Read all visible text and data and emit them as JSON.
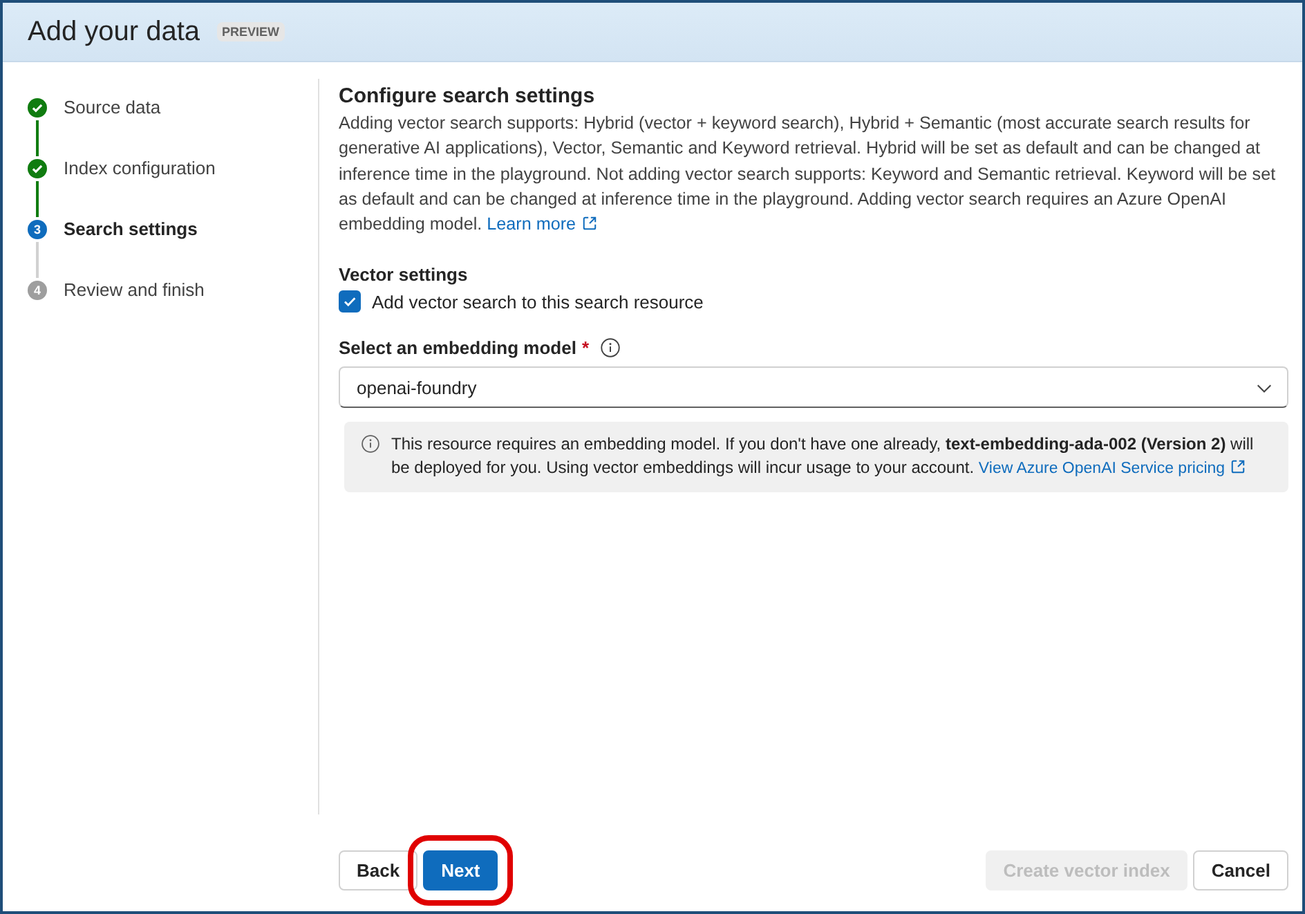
{
  "header": {
    "title": "Add your data",
    "badge": "PREVIEW"
  },
  "steps": [
    {
      "label": "Source data",
      "kind": "done"
    },
    {
      "label": "Index configuration",
      "kind": "done"
    },
    {
      "number": "3",
      "label": "Search settings",
      "kind": "current"
    },
    {
      "number": "4",
      "label": "Review and finish",
      "kind": "pending"
    }
  ],
  "section": {
    "title": "Configure search settings",
    "description": "Adding vector search supports: Hybrid (vector + keyword search), Hybrid + Semantic (most accurate search results for generative AI applications), Vector, Semantic and Keyword retrieval. Hybrid will be set as default and can be changed at inference time in the playground. Not adding vector search supports: Keyword and Semantic retrieval. Keyword will be set as default and can be changed at inference time in the playground. Adding vector search requires an Azure OpenAI embedding model.",
    "link": "Learn more"
  },
  "vector_settings": {
    "title": "Vector settings",
    "checkbox": {
      "label": "Add vector search to this search resource",
      "checked": true
    }
  },
  "model_select": {
    "label": "Select an embedding model",
    "required_mark": "*",
    "value": "openai-foundry"
  },
  "info": {
    "text": "This resource requires an embedding model. If you don't have one already, **text-embedding-ada-002 (Version 2)** will be deployed for you. Using vector embeddings will incur usage to your account.",
    "link": "View Azure OpenAI Service pricing"
  },
  "buttons": [
    {
      "label": "Back",
      "kind": "secondary",
      "disabled": false,
      "highlighted": false
    },
    {
      "label": "Next",
      "kind": "primary",
      "disabled": false,
      "highlighted": true
    },
    {
      "label": "Create vector index",
      "kind": "primary",
      "disabled": true,
      "highlighted": false
    },
    {
      "label": "Cancel",
      "kind": "secondary",
      "disabled": false,
      "highlighted": false
    }
  ]
}
